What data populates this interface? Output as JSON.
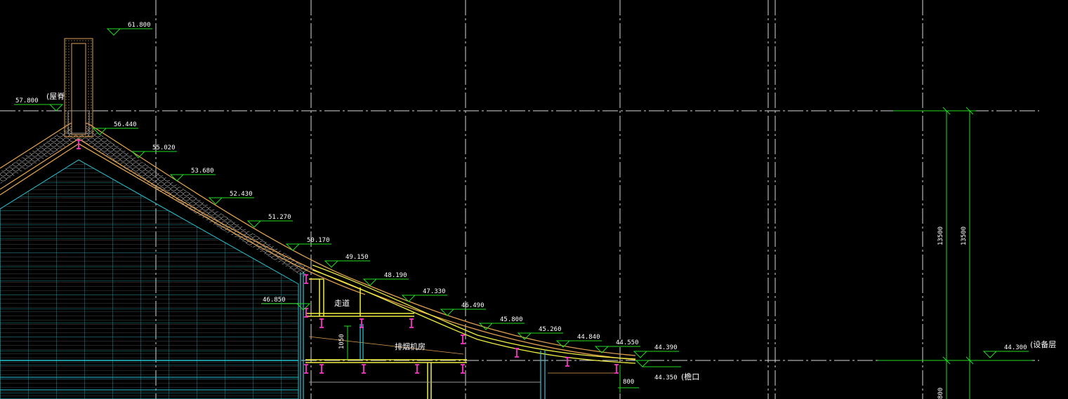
{
  "elevations": [
    {
      "id": "ridge-top",
      "text": "61.800"
    },
    {
      "id": "ridge",
      "text": "57.800"
    },
    {
      "id": "r1",
      "text": "56.440"
    },
    {
      "id": "r2",
      "text": "55.020"
    },
    {
      "id": "r3",
      "text": "53.680"
    },
    {
      "id": "r4",
      "text": "52.430"
    },
    {
      "id": "r5",
      "text": "51.270"
    },
    {
      "id": "r6",
      "text": "50.170"
    },
    {
      "id": "r7",
      "text": "49.150"
    },
    {
      "id": "r8",
      "text": "48.190"
    },
    {
      "id": "r9",
      "text": "47.330"
    },
    {
      "id": "r10",
      "text": "46.490"
    },
    {
      "id": "r11",
      "text": "45.800"
    },
    {
      "id": "r12",
      "text": "45.260"
    },
    {
      "id": "r13",
      "text": "44.840"
    },
    {
      "id": "r14",
      "text": "44.550"
    },
    {
      "id": "r15",
      "text": "44.390"
    },
    {
      "id": "wall",
      "text": "46.850"
    },
    {
      "id": "eave",
      "text": "44.350"
    },
    {
      "id": "equip",
      "text": "44.300"
    }
  ],
  "labels": {
    "ridge_name": "(屋脊",
    "walkway": "走道",
    "fan_room": "排烟机房",
    "eave_name": "(檐口",
    "equip_floor": "(设备层"
  },
  "dimensions": {
    "d1": "13500",
    "d2": "13500",
    "room_height": "1050",
    "eave_drop": "800",
    "bottom": "800"
  },
  "colors": {
    "background": "#000000",
    "axis": "#d9d9d9",
    "roof": "#e0a050",
    "tile": "#a0a0a0",
    "glass": "#28c8d8",
    "elev": "#22dd22",
    "slab": "#f0f040",
    "marker": "#ff30c8"
  }
}
